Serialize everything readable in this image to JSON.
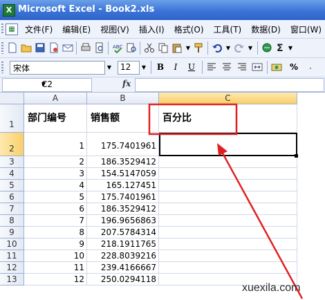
{
  "window": {
    "title": "Microsoft Excel - Book2.xls",
    "app_icon": "excel-icon"
  },
  "menu": {
    "items": [
      "文件(F)",
      "编辑(E)",
      "视图(V)",
      "插入(I)",
      "格式(O)",
      "工具(T)",
      "数据(D)",
      "窗口(W)"
    ]
  },
  "format": {
    "font_name": "宋体",
    "font_size": "12",
    "bold": "B",
    "italic": "I",
    "underline": "U",
    "percent": "%"
  },
  "formula_bar": {
    "name_box": "C2",
    "fx": "fx",
    "content": ""
  },
  "grid": {
    "columns": [
      "A",
      "B",
      "C"
    ],
    "row_numbers": [
      "1",
      "2",
      "3",
      "4",
      "5",
      "6",
      "7",
      "8",
      "9",
      "10",
      "11",
      "12",
      "13"
    ],
    "headers": {
      "a1": "部门编号",
      "b1": "销售额",
      "c1": "百分比"
    },
    "rows": [
      {
        "a": "1",
        "b": "175.7401961",
        "c": ""
      },
      {
        "a": "2",
        "b": "186.3529412",
        "c": ""
      },
      {
        "a": "3",
        "b": "154.5147059",
        "c": ""
      },
      {
        "a": "4",
        "b": "165.127451",
        "c": ""
      },
      {
        "a": "5",
        "b": "175.7401961",
        "c": ""
      },
      {
        "a": "6",
        "b": "186.3529412",
        "c": ""
      },
      {
        "a": "7",
        "b": "196.9656863",
        "c": ""
      },
      {
        "a": "8",
        "b": "207.5784314",
        "c": ""
      },
      {
        "a": "9",
        "b": "218.1911765",
        "c": ""
      },
      {
        "a": "10",
        "b": "228.8039216",
        "c": ""
      },
      {
        "a": "11",
        "b": "239.4166667",
        "c": ""
      },
      {
        "a": "12",
        "b": "250.0294118",
        "c": ""
      }
    ],
    "active_cell": "C2"
  },
  "annotation": {
    "color": "#e02020"
  },
  "watermark": "xuexila.com"
}
